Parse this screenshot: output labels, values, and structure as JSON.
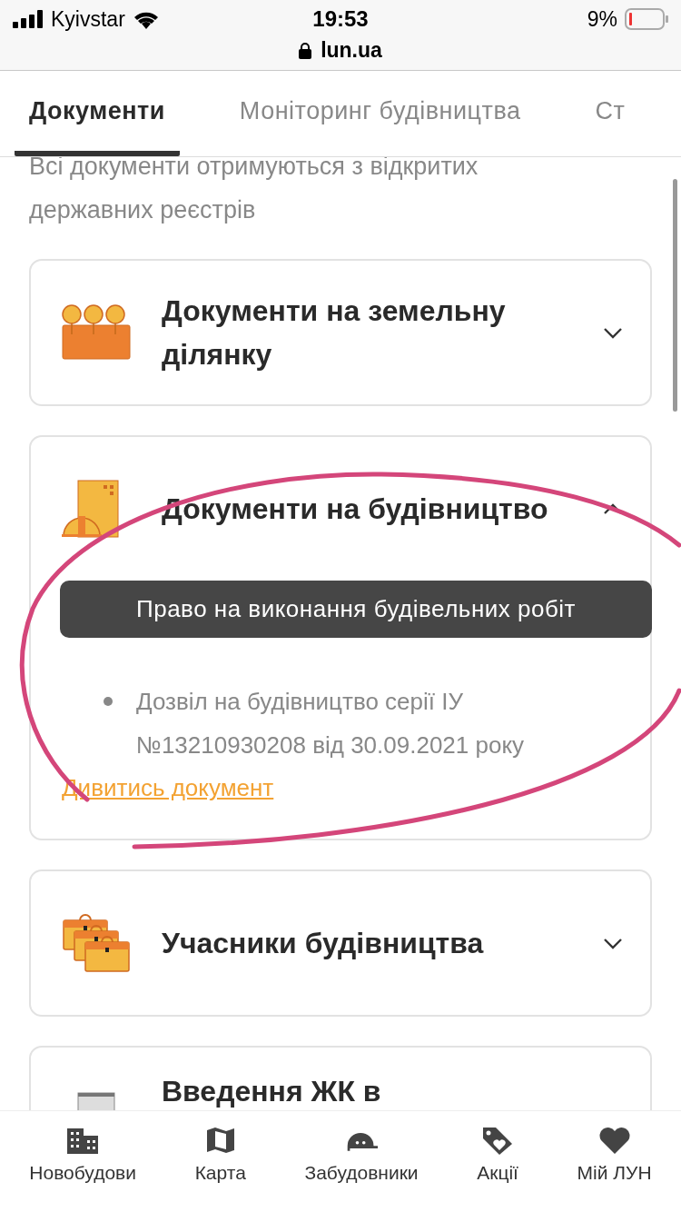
{
  "status_bar": {
    "carrier": "Kyivstar",
    "time": "19:53",
    "battery": "9%"
  },
  "address_bar": {
    "url": "lun.ua"
  },
  "tabs": [
    {
      "label": "Документи",
      "selected": true
    },
    {
      "label": "Моніторинг будівництва",
      "selected": false
    },
    {
      "label": "Ст",
      "selected": false
    }
  ],
  "intro": "Всі документи отримуються з відкритих державних реєстрів",
  "sections": [
    {
      "title": "Документи на земельну ділянку",
      "expanded": false
    },
    {
      "title": "Документи на будівництво",
      "expanded": true,
      "tooltip": "Право на виконання будівельних робіт",
      "documents": [
        "Дозвіл на будівництво серії ІУ №13210930208 від 30.09.2021 року"
      ],
      "link": "Дивитись документ"
    },
    {
      "title": "Учасники будівництва",
      "expanded": false
    },
    {
      "title": "Введення ЖК в"
    }
  ],
  "bottom_nav": [
    {
      "label": "Новобудови"
    },
    {
      "label": "Карта"
    },
    {
      "label": "Забудовники"
    },
    {
      "label": "Акції"
    },
    {
      "label": "Мій ЛУН"
    }
  ]
}
